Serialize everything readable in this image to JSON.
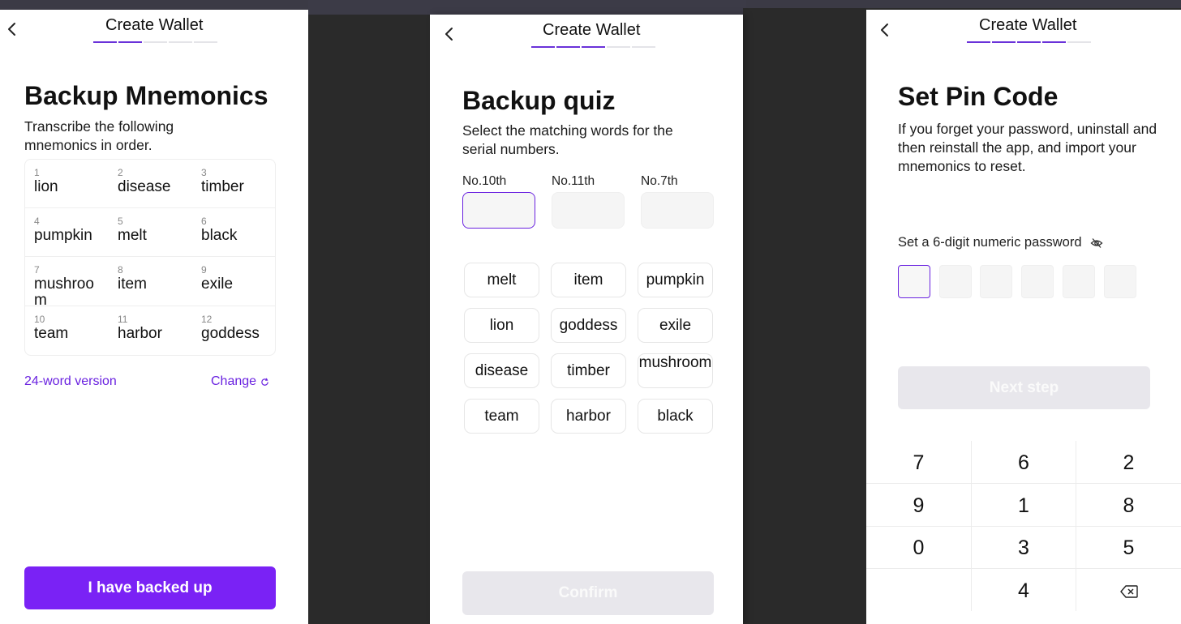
{
  "colors": {
    "accent": "#7a22f5",
    "accent_dark": "#6a22e0",
    "disabled_button": "#e8e7ec"
  },
  "icons": {
    "back": "chevron-left-icon",
    "refresh": "refresh-icon",
    "eye_off": "eye-off-icon",
    "backspace": "backspace-icon"
  },
  "mnemonics_screen": {
    "header_title": "Create Wallet",
    "steps_total": 5,
    "steps_done": 2,
    "title": "Backup Mnemonics",
    "description": "Transcribe the following mnemonics in order.",
    "words": [
      {
        "num": "1",
        "word": "lion"
      },
      {
        "num": "2",
        "word": "disease"
      },
      {
        "num": "3",
        "word": "timber"
      },
      {
        "num": "4",
        "word": "pumpkin"
      },
      {
        "num": "5",
        "word": "melt"
      },
      {
        "num": "6",
        "word": "black"
      },
      {
        "num": "7",
        "word": "mushroom"
      },
      {
        "num": "8",
        "word": "item"
      },
      {
        "num": "9",
        "word": "exile"
      },
      {
        "num": "10",
        "word": "team"
      },
      {
        "num": "11",
        "word": "harbor"
      },
      {
        "num": "12",
        "word": "goddess"
      }
    ],
    "version_link": "24-word version",
    "change_link": "Change",
    "primary_button": "I have backed up"
  },
  "quiz_screen": {
    "header_title": "Create Wallet",
    "steps_total": 5,
    "steps_done": 3,
    "title": "Backup quiz",
    "description": "Select the matching words for the serial numbers.",
    "slots": [
      {
        "label": "No.10th",
        "value": ""
      },
      {
        "label": "No.11th",
        "value": ""
      },
      {
        "label": "No.7th",
        "value": ""
      }
    ],
    "chips": [
      "melt",
      "item",
      "pumpkin",
      "lion",
      "goddess",
      "exile",
      "disease",
      "timber",
      "mushroom",
      "team",
      "harbor",
      "black"
    ],
    "confirm_button": "Confirm"
  },
  "pin_screen": {
    "header_title": "Create Wallet",
    "steps_total": 5,
    "steps_done": 4,
    "title": "Set Pin Code",
    "description": "If you forget your password, uninstall and then reinstall the app, and import your mnemonics to reset.",
    "password_label": "Set a 6-digit numeric password",
    "pin_length": 6,
    "next_button": "Next step",
    "keypad": [
      "7",
      "6",
      "2",
      "9",
      "1",
      "8",
      "0",
      "3",
      "5",
      "",
      "4",
      "backspace"
    ]
  }
}
